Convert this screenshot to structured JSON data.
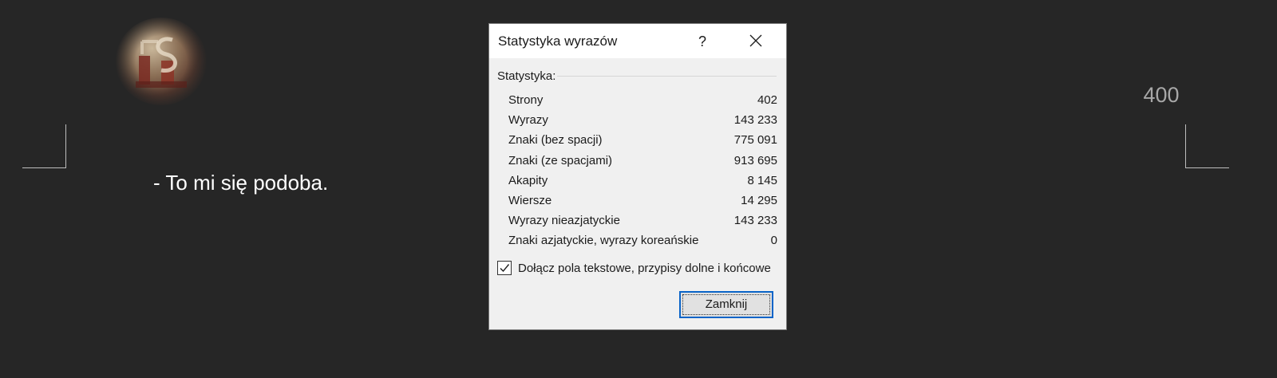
{
  "document": {
    "page_number": "400",
    "text_line": "- To mi się podoba."
  },
  "dialog": {
    "title": "Statystyka wyrazów",
    "help_label": "?",
    "group_label": "Statystyka:",
    "stats": [
      {
        "label": "Strony",
        "value": "402"
      },
      {
        "label": "Wyrazy",
        "value": "143 233"
      },
      {
        "label": "Znaki (bez spacji)",
        "value": "775 091"
      },
      {
        "label": "Znaki (ze spacjami)",
        "value": "913 695"
      },
      {
        "label": "Akapity",
        "value": "8 145"
      },
      {
        "label": "Wiersze",
        "value": "14 295"
      },
      {
        "label": "Wyrazy nieazjatyckie",
        "value": "143 233"
      },
      {
        "label": "Znaki azjatyckie, wyrazy koreańskie",
        "value": "0"
      }
    ],
    "include_checkbox": {
      "label": "Dołącz pola tekstowe, przypisy dolne i końcowe",
      "checked": true
    },
    "close_button_label": "Zamknij"
  },
  "icons": {
    "close": "close-icon",
    "check": "checkmark-icon",
    "logo": "logo-icon"
  },
  "colors": {
    "background": "#262626",
    "dialog": "#f0f0f0",
    "accent": "#0a64c8"
  }
}
